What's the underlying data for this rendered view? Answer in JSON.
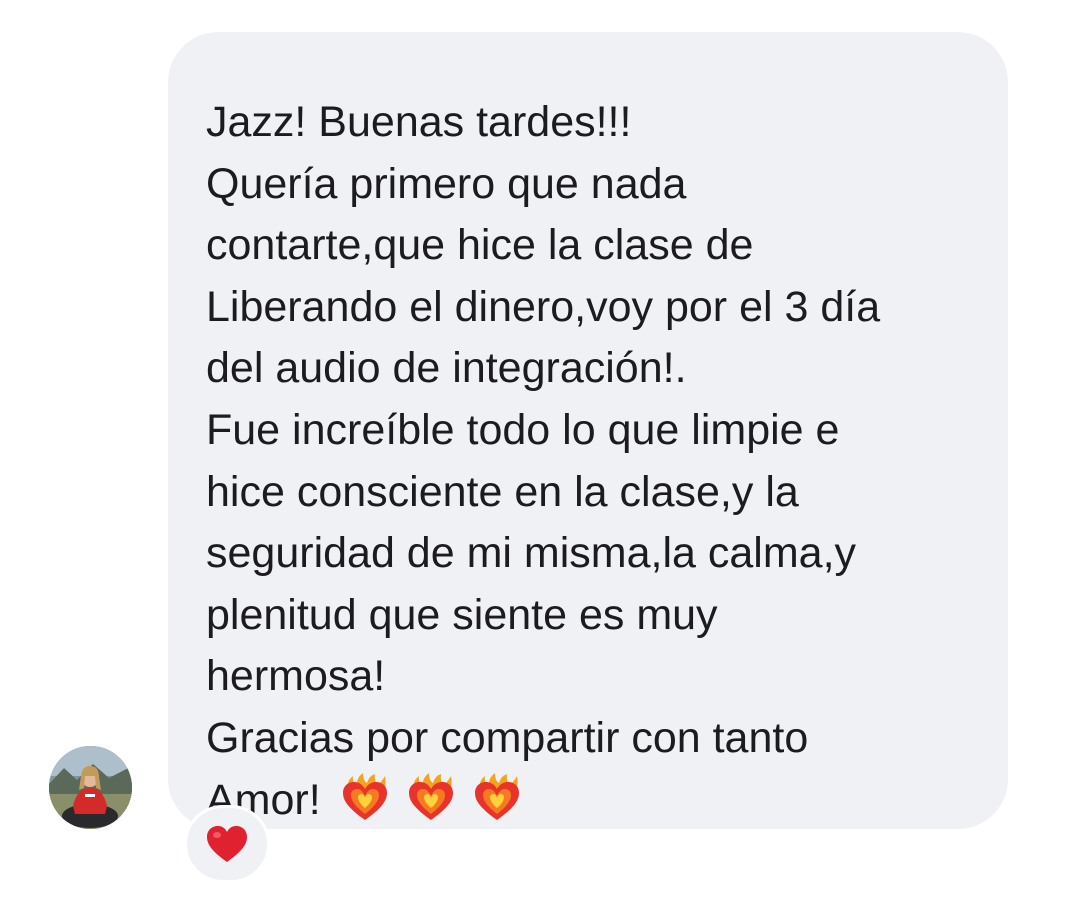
{
  "message": {
    "lines": [
      "Jazz! Buenas tardes!!!",
      "Quería primero que nada",
      "contarte,que hice la clase de",
      "Liberando el dinero,voy por el 3 día",
      "del audio de integración!.",
      "Fue increíble todo lo que limpie e",
      "hice consciente en la clase,y la",
      "seguridad de mi misma,la calma,y",
      "plenitud que siente es muy",
      "hermosa!",
      "Gracias por compartir con tanto",
      "Amor!"
    ],
    "trailing_emoji": [
      "heart-on-fire-icon",
      "heart-on-fire-icon",
      "heart-on-fire-icon"
    ],
    "bubble_color": "#f0f1f4",
    "text_color": "#1c1c1e"
  },
  "sender": {
    "avatar_icon": "user-avatar"
  },
  "reaction": {
    "icon": "red-heart-icon",
    "color": "#e0212f"
  }
}
